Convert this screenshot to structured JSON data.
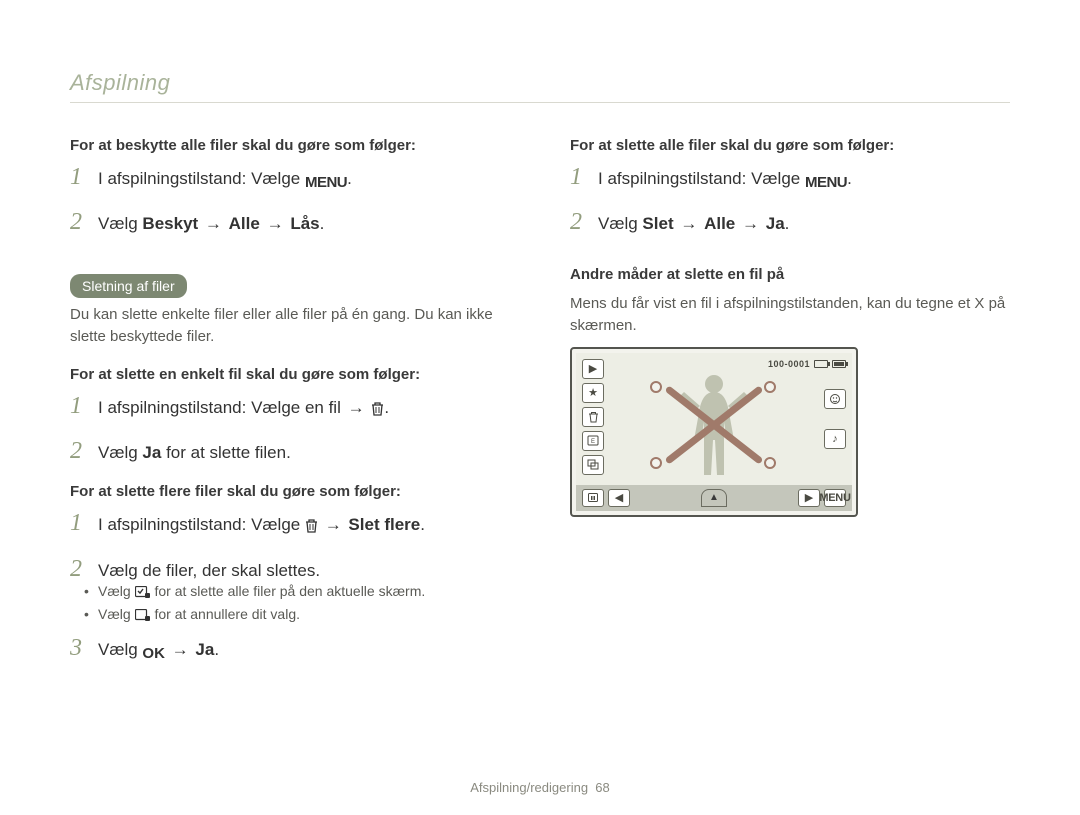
{
  "breadcrumb": "Afspilning",
  "footer": {
    "section": "Afspilning/redigering",
    "page": "68"
  },
  "icons": {
    "menu": "MENU",
    "trash": "trash-icon",
    "ok": "OK",
    "select_all": "select-all-icon",
    "deselect": "deselect-icon"
  },
  "left": {
    "protect_all": {
      "intro": "For at beskytte alle filer skal du gøre som følger:",
      "step1_a": "I afspilningstilstand: Vælge ",
      "step1_b": ".",
      "step2_a": "Vælg ",
      "step2_b": "Beskyt",
      "step2_c": "Alle",
      "step2_d": "Lås",
      "step2_e": "."
    },
    "delete_heading": "Sletning af filer",
    "delete_intro": "Du kan slette enkelte filer eller alle filer på én gang. Du kan ikke slette beskyttede filer.",
    "delete_one": {
      "intro": "For at slette en enkelt fil skal du gøre som følger:",
      "step1_a": "I afspilningstilstand: Vælge en fil ",
      "step1_b": ".",
      "step2_a": "Vælg ",
      "step2_b": "Ja",
      "step2_c": " for at slette filen."
    },
    "delete_multi": {
      "intro": "For at slette flere filer skal du gøre som følger:",
      "step1_a": "I afspilningstilstand: Vælge ",
      "step1_b": "Slet flere",
      "step1_c": ".",
      "step2": "Vælg de filer, der skal slettes.",
      "bullet1_a": "Vælg ",
      "bullet1_b": " for at slette alle filer på den aktuelle skærm.",
      "bullet2_a": "Vælg ",
      "bullet2_b": " for at annullere dit valg.",
      "step3_a": "Vælg ",
      "step3_b": "Ja",
      "step3_c": "."
    }
  },
  "right": {
    "delete_all": {
      "intro": "For at slette alle filer skal du gøre som følger:",
      "step1_a": "I afspilningstilstand: Vælge ",
      "step1_b": ".",
      "step2_a": "Vælg ",
      "step2_b": "Slet",
      "step2_c": "Alle",
      "step2_d": "Ja",
      "step2_e": "."
    },
    "other_heading": "Andre måder at slette en fil på",
    "other_body": "Mens du får vist en fil i afspilningstilstanden, kan du tegne et X på skærmen.",
    "camera": {
      "file_counter": "100-0001",
      "menu_label": "MENU"
    }
  },
  "arrow": "→"
}
